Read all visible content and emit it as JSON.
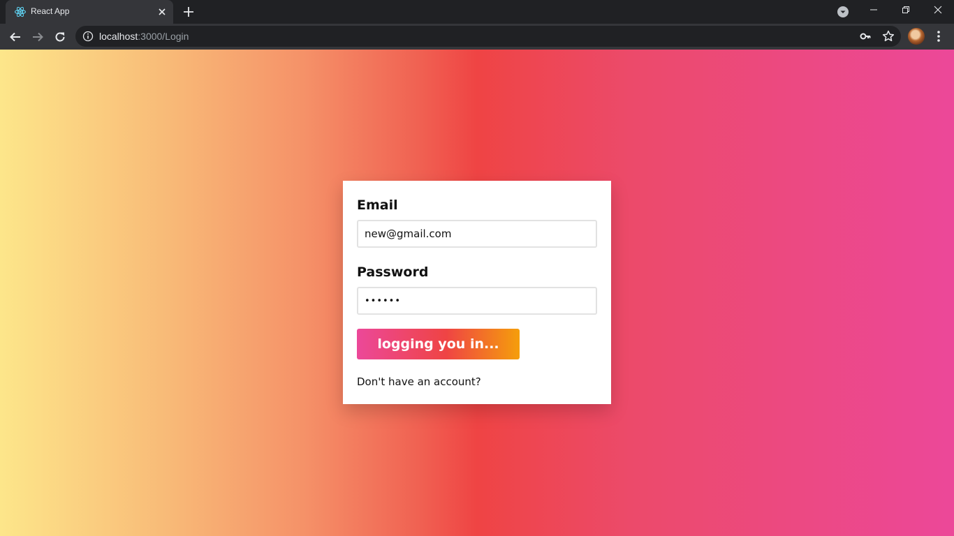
{
  "browser": {
    "tab": {
      "title": "React App",
      "favicon": "react-logo-icon",
      "close_icon": "close-icon"
    },
    "new_tab_icon": "plus-icon",
    "tab_search_icon": "chevron-down-circle-icon",
    "window_controls": {
      "minimize": "minimize-icon",
      "maximize": "restore-icon",
      "close": "close-icon"
    },
    "address": {
      "host": "localhost",
      "path": ":3000/Login",
      "info_icon": "info-icon",
      "key_icon": "key-icon",
      "star_icon": "star-icon"
    },
    "colors": {
      "tabstrip": "#202124",
      "toolbar": "#35363a",
      "omnibox": "#202124"
    }
  },
  "page": {
    "background_gradient": [
      "#fde68a",
      "#ef4444",
      "#ec4899"
    ],
    "form": {
      "email_label": "Email",
      "email_value": "new@gmail.com",
      "password_label": "Password",
      "password_value": "••••••",
      "submit_label": "logging you in...",
      "signup_text": "Don't have an account?"
    },
    "button_gradient": [
      "#ec4899",
      "#ef4444",
      "#f59e0b"
    ]
  }
}
